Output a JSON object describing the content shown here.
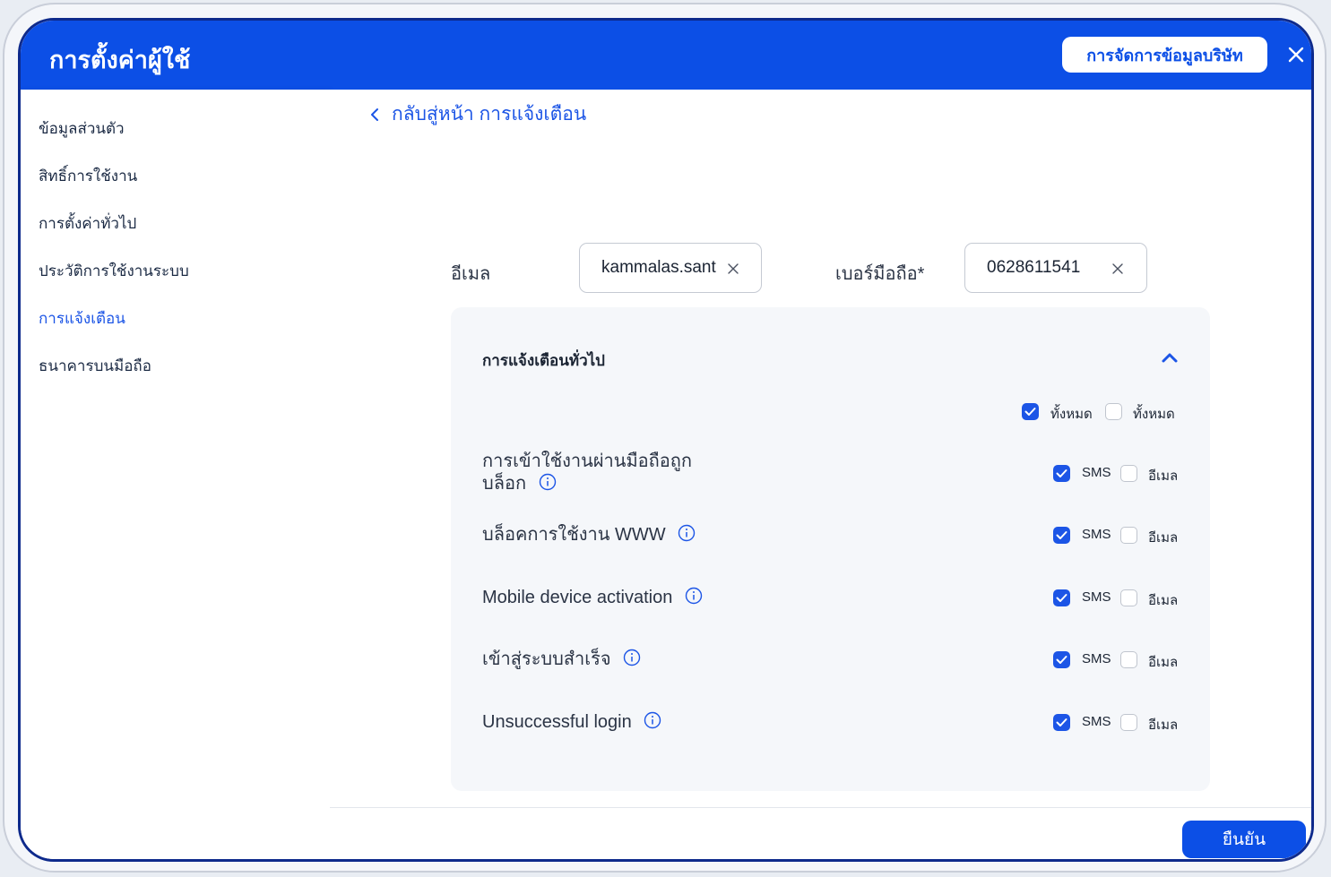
{
  "header": {
    "title": "การตั้งค่าผู้ใช้",
    "company_button": "การจัดการข้อมูลบริษัท"
  },
  "sidebar": {
    "items": [
      {
        "label": "ข้อมูลส่วนตัว"
      },
      {
        "label": "สิทธิ์การใช้งาน"
      },
      {
        "label": "การตั้งค่าทั่วไป"
      },
      {
        "label": "ประวัติการใช้งานระบบ"
      },
      {
        "label": "การแจ้งเตือน",
        "active": true
      },
      {
        "label": "ธนาคารบนมือถือ"
      }
    ]
  },
  "main": {
    "back_link": "กลับสู่หน้า การแจ้งเตือน",
    "email_label": "อีเมล",
    "email_value": "kammalas.sant",
    "phone_label": "เบอร์มือถือ*",
    "phone_value": "0628611541"
  },
  "card": {
    "title": "การแจ้งเตือนทั่วไป",
    "select_all_1": "ทั้งหมด",
    "select_all_1_checked": true,
    "select_all_2": "ทั้งหมด",
    "select_all_2_checked": false,
    "sms_label": "SMS",
    "email_label": "อีเมล",
    "rows": [
      {
        "line1": "การเข้าใช้งานผ่านมือถือถูก",
        "line2": "บล็อก",
        "sms": true,
        "email": false
      },
      {
        "line1": "บล็อคการใช้งาน WWW",
        "sms": true,
        "email": false
      },
      {
        "line1": "Mobile device activation",
        "sms": true,
        "email": false
      },
      {
        "line1": "เข้าสู่ระบบสำเร็จ",
        "sms": true,
        "email": false
      },
      {
        "line1": "Unsuccessful login",
        "sms": true,
        "email": false
      }
    ]
  },
  "footer": {
    "confirm": "ยืนยัน"
  },
  "colors": {
    "primary": "#0c4fe6",
    "link": "#1c55e6"
  }
}
